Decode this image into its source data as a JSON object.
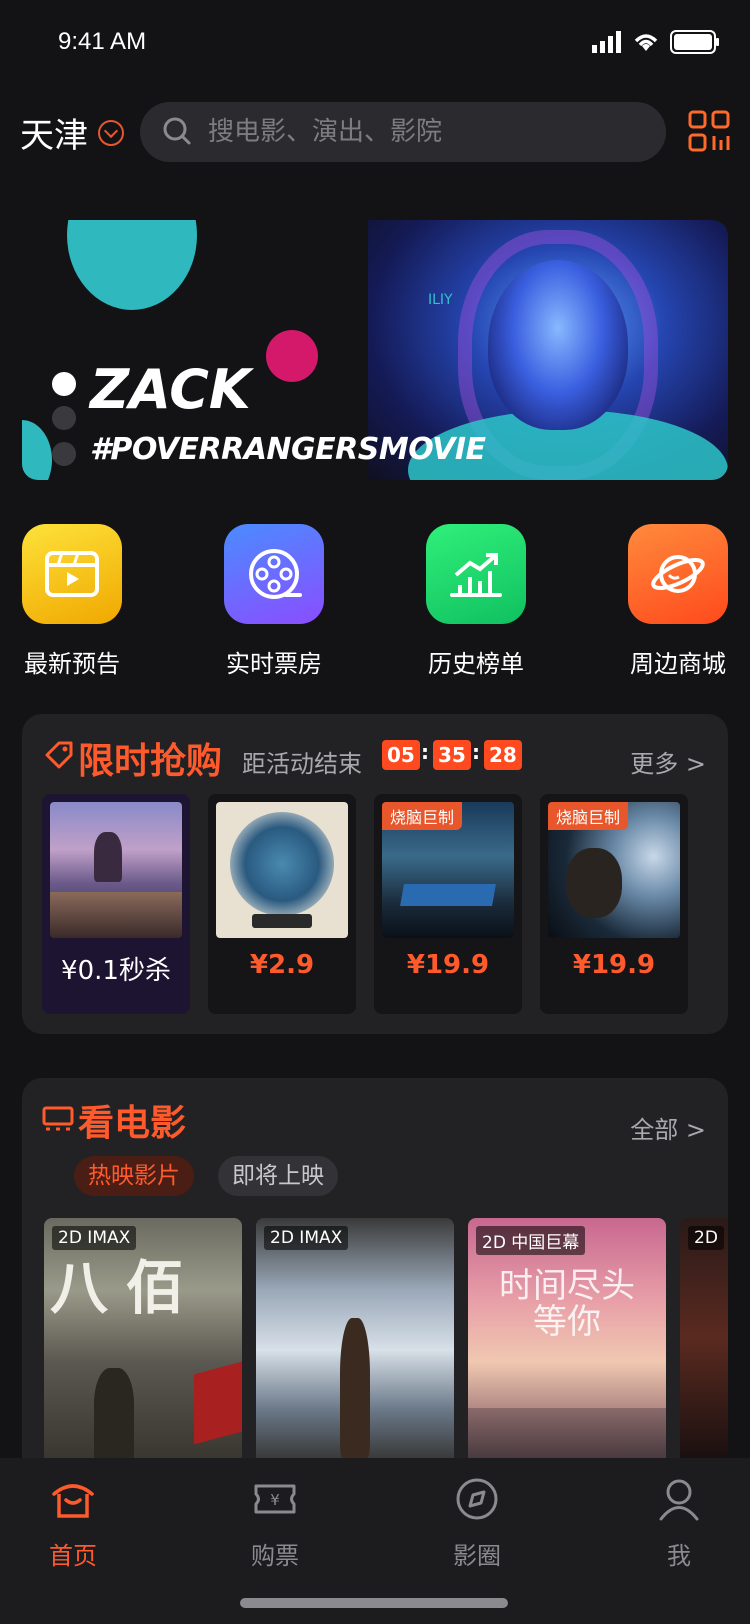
{
  "status_bar": {
    "time": "9:41 AM"
  },
  "header": {
    "city": "天津",
    "search_placeholder": "搜电影、演出、影院"
  },
  "banner": {
    "title": "ZACK",
    "subtitle": "#POVERRANGERSMOVIE",
    "vertical_text": "ILIY"
  },
  "quick_menu": [
    {
      "label": "最新预告",
      "icon": "video-clapper-icon",
      "color": "#f6c40a"
    },
    {
      "label": "实时票房",
      "icon": "film-reel-icon",
      "color": "#6a73ff"
    },
    {
      "label": "历史榜单",
      "icon": "trend-chart-icon",
      "color": "#1fd16b"
    },
    {
      "label": "周边商城",
      "icon": "planet-icon",
      "color": "#ff6a2a"
    }
  ],
  "flash_sale": {
    "title": "限时抢购",
    "countdown_label": "距活动结束",
    "hours": "05",
    "minutes": "35",
    "seconds": "28",
    "more": "更多 >",
    "items": [
      {
        "price": "¥0.1秒杀",
        "badge": ""
      },
      {
        "price": "¥2.9",
        "badge": ""
      },
      {
        "price": "¥19.9",
        "badge": "烧脑巨制"
      },
      {
        "price": "¥19.9",
        "badge": "烧脑巨制"
      }
    ]
  },
  "movies": {
    "title": "看电影",
    "all": "全部 >",
    "tabs": [
      "热映影片",
      "即将上映"
    ],
    "posters": [
      {
        "badge": "2D IMAX"
      },
      {
        "badge": "2D IMAX"
      },
      {
        "badge": "2D 中国巨幕"
      },
      {
        "badge": "2D"
      }
    ]
  },
  "tab_bar": [
    {
      "label": "首页",
      "icon": "home-icon",
      "active": true
    },
    {
      "label": "购票",
      "icon": "ticket-icon",
      "active": false
    },
    {
      "label": "影圈",
      "icon": "compass-icon",
      "active": false
    },
    {
      "label": "我",
      "icon": "profile-icon",
      "active": false
    }
  ],
  "colors": {
    "accent": "#ff5a2c",
    "background": "#131315",
    "card": "#222225"
  }
}
